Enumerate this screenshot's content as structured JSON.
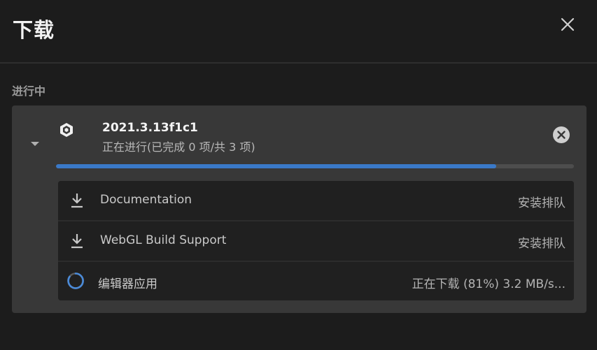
{
  "header": {
    "title": "下载",
    "close_icon": "close-icon"
  },
  "section": {
    "label": "进行中"
  },
  "download": {
    "version": "2021.3.13f1c1",
    "status": "正在进行(已完成 0 项/共 3 项)",
    "progress_percent": 85,
    "icon": "unity-cube-icon",
    "items": [
      {
        "label": "Documentation",
        "status": "安装排队",
        "icon": "download-icon"
      },
      {
        "label": "WebGL Build Support",
        "status": "安装排队",
        "icon": "download-icon"
      },
      {
        "label": "编辑器应用",
        "status": "正在下载 (81%) 3.2 MB/s...",
        "icon": "spinner-icon"
      }
    ]
  },
  "colors": {
    "background": "#1c1c1c",
    "card": "#383838",
    "accent": "#3a79c8",
    "list_bg": "#202020"
  }
}
